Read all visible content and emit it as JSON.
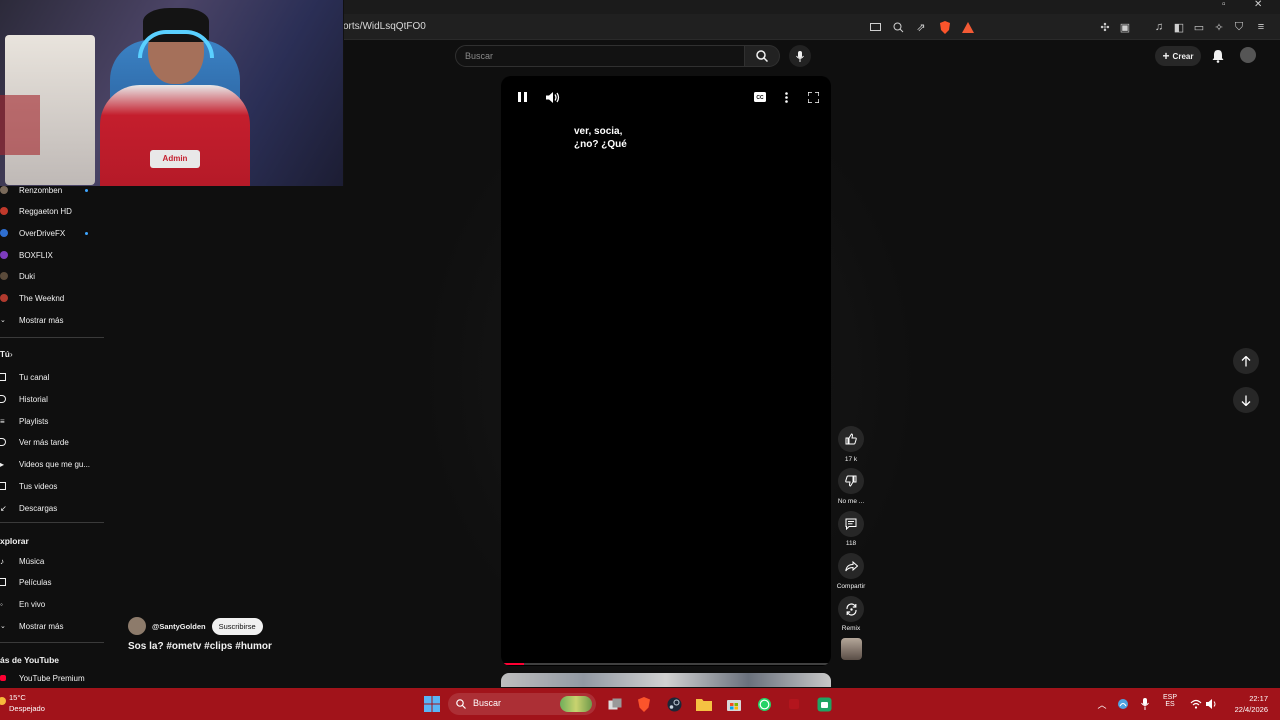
{
  "browser": {
    "url_fragment": "orts/WidLsqQtFO0"
  },
  "header": {
    "search_placeholder": "Buscar",
    "create_label": "Crear"
  },
  "sidebar": {
    "subscriptions": [
      {
        "label": "Renzomben",
        "new": true
      },
      {
        "label": "Reggaeton HD",
        "new": false
      },
      {
        "label": "OverDriveFX",
        "new": true
      },
      {
        "label": "BOXFLIX",
        "new": false
      },
      {
        "label": "Duki",
        "new": false
      },
      {
        "label": "The Weeknd",
        "new": false
      },
      {
        "label": "Mostrar más",
        "new": false
      }
    ],
    "you_heading": "Tú",
    "you_items": [
      {
        "label": "Tu canal"
      },
      {
        "label": "Historial"
      },
      {
        "label": "Playlists"
      },
      {
        "label": "Ver más tarde"
      },
      {
        "label": "Videos que me gu..."
      },
      {
        "label": "Tus videos"
      },
      {
        "label": "Descargas"
      }
    ],
    "explore_heading": "xplorar",
    "explore_items": [
      {
        "label": "Música"
      },
      {
        "label": "Películas"
      },
      {
        "label": "En vivo"
      },
      {
        "label": "Mostrar más"
      }
    ],
    "more_heading": "ás de YouTube",
    "more_items": [
      {
        "label": "YouTube Premium"
      }
    ]
  },
  "short": {
    "caption_line1": "ver, socia,",
    "caption_line2": "¿no? ¿Qué",
    "progress": 0.07,
    "channel": "@SantyGolden",
    "subscribe_label": "Suscribirse",
    "title": "Sos la? #ometv #clips #humor"
  },
  "actions": {
    "likes": "17 k",
    "dislike_label": "No me ...",
    "comments": "118",
    "share_label": "Compartir",
    "remix_label": "Remix"
  },
  "webcam": {
    "shirt_text": "Admin"
  },
  "taskbar": {
    "weather_temp": "15°C",
    "weather_desc": "Despejado",
    "search_label": "Buscar",
    "lang_line1": "ESP",
    "lang_line2": "ES",
    "time": "22:17",
    "date": "22/4/2026"
  }
}
